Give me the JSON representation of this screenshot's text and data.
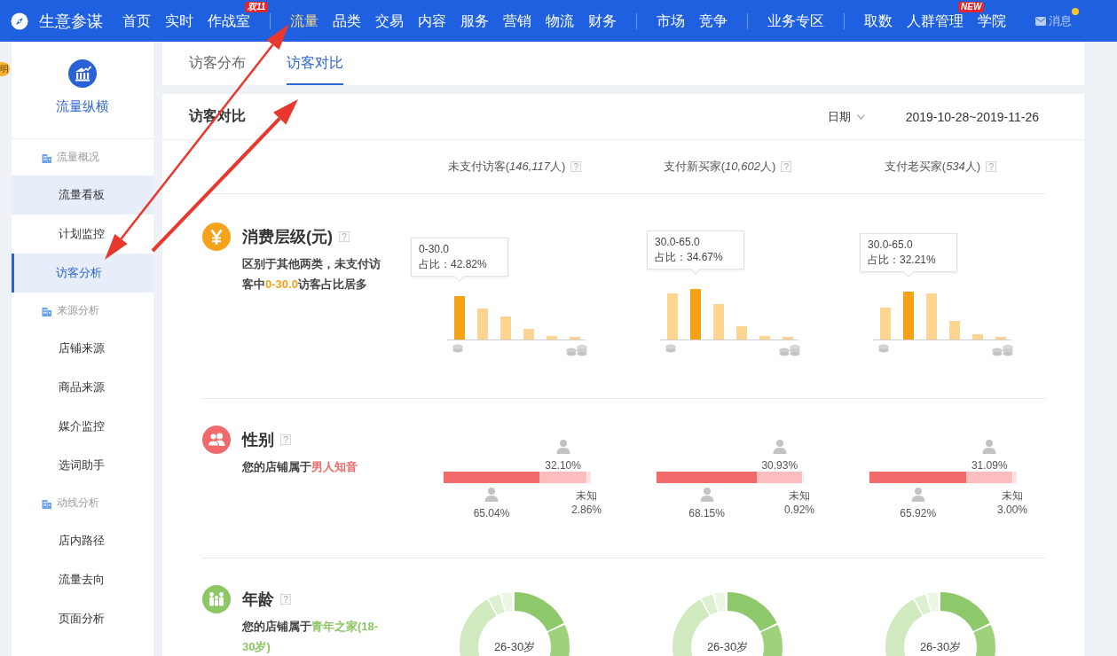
{
  "nav": {
    "brand": "生意参谋",
    "groups": [
      [
        {
          "label": "首页",
          "selected": false
        },
        {
          "label": "实时",
          "selected": false
        },
        {
          "label": "作战室",
          "selected": false,
          "badge": "双11"
        }
      ],
      [
        {
          "label": "流量",
          "selected": true
        },
        {
          "label": "品类",
          "selected": false
        },
        {
          "label": "交易",
          "selected": false
        },
        {
          "label": "内容",
          "selected": false
        },
        {
          "label": "服务",
          "selected": false
        },
        {
          "label": "营销",
          "selected": false
        },
        {
          "label": "物流",
          "selected": false
        },
        {
          "label": "财务",
          "selected": false
        }
      ],
      [
        {
          "label": "市场",
          "selected": false
        },
        {
          "label": "竞争",
          "selected": false
        }
      ],
      [
        {
          "label": "业务专区",
          "selected": false
        }
      ],
      [
        {
          "label": "取数",
          "selected": false
        },
        {
          "label": "人群管理",
          "selected": false,
          "badge": "NEW"
        },
        {
          "label": "学院",
          "selected": false
        }
      ]
    ],
    "messages": {
      "label": "消息",
      "unread": true
    }
  },
  "edge_tab": "明",
  "sidebar": {
    "title": "流量纵横",
    "groups": [
      {
        "label": "流量概况",
        "items": [
          {
            "label": "流量看板",
            "selected": false,
            "highlighted": true
          },
          {
            "label": "计划监控",
            "selected": false,
            "highlighted": false
          },
          {
            "label": "访客分析",
            "selected": true,
            "highlighted": false
          }
        ]
      },
      {
        "label": "来源分析",
        "items": [
          {
            "label": "店铺来源",
            "selected": false,
            "highlighted": false
          },
          {
            "label": "商品来源",
            "selected": false,
            "highlighted": false
          },
          {
            "label": "媒介监控",
            "selected": false,
            "highlighted": false
          },
          {
            "label": "选词助手",
            "selected": false,
            "highlighted": false
          }
        ]
      },
      {
        "label": "动线分析",
        "items": [
          {
            "label": "店内路径",
            "selected": false,
            "highlighted": false
          },
          {
            "label": "流量去向",
            "selected": false,
            "highlighted": false
          },
          {
            "label": "页面分析",
            "selected": false,
            "highlighted": false
          }
        ]
      }
    ]
  },
  "tabs": [
    {
      "label": "访客分布",
      "selected": false
    },
    {
      "label": "访客对比",
      "selected": true
    }
  ],
  "panel": {
    "title": "访客对比",
    "date_label": "日期",
    "date_range": "2019-10-28~2019-11-26",
    "columns": [
      {
        "label_before": "未支付访客(",
        "count": "146,117",
        "label_after": "人)",
        "help": "?"
      },
      {
        "label_before": "支付新买家(",
        "count": "10,602",
        "label_after": "人)",
        "help": "?"
      },
      {
        "label_before": "支付老买家(",
        "count": "534",
        "label_after": "人)",
        "help": "?"
      }
    ],
    "sections": [
      {
        "kind": "spending",
        "title": "消费层级(元)",
        "help": "?",
        "color": "#f5a31a",
        "description": "区别于其他两类，未支付访客中**0-30.0**访客占比居多",
        "charts": [
          {
            "bars": [
              {
                "selected": true
              },
              {
                "selected": false
              },
              {
                "selected": false
              },
              {
                "selected": false
              },
              {
                "selected": false
              },
              {
                "selected": false
              }
            ],
            "tooltip": {
              "range": "0-30.0",
              "share": "占比：42.82%"
            }
          },
          {
            "bars": [
              {
                "selected": false
              },
              {
                "selected": true
              },
              {
                "selected": false
              },
              {
                "selected": false
              },
              {
                "selected": false
              },
              {
                "selected": false
              }
            ],
            "tooltip": {
              "range": "30.0-65.0",
              "share": "占比：34.67%"
            }
          },
          {
            "bars": [
              {
                "selected": false
              },
              {
                "selected": true
              },
              {
                "selected": false
              },
              {
                "selected": false
              },
              {
                "selected": false
              },
              {
                "selected": false
              }
            ],
            "tooltip": {
              "range": "30.0-65.0",
              "share": "占比：32.21%"
            }
          }
        ]
      },
      {
        "kind": "gender",
        "title": "性别",
        "help": "?",
        "color": "#f0696b",
        "description": "您的店铺属于**男人知音**",
        "charts": [
          {
            "female": {
              "level": 0.321,
              "value": "32.10%"
            },
            "male": {
              "level": 0.6504,
              "value": "65.04%"
            },
            "unknown": {
              "level": 0.0286,
              "label": "未知",
              "value": "2.86%"
            }
          },
          {
            "female": {
              "level": 0.3093,
              "value": "30.93%"
            },
            "male": {
              "level": 0.6815,
              "value": "68.15%"
            },
            "unknown": {
              "level": 0.0092,
              "label": "未知",
              "value": "0.92%"
            }
          },
          {
            "female": {
              "level": 0.3109,
              "value": "31.09%"
            },
            "male": {
              "level": 0.6592,
              "value": "65.92%"
            },
            "unknown": {
              "level": 0.03,
              "label": "未知",
              "value": "3.00%"
            }
          }
        ]
      },
      {
        "kind": "age",
        "title": "年龄",
        "help": "?",
        "color": "#8cc665",
        "description": "您的店铺属于**青年之家(18-30岁)**",
        "charts": [
          {
            "center": "26-30岁"
          },
          {
            "center": "26-30岁"
          },
          {
            "center": "26-30岁"
          }
        ]
      }
    ]
  }
}
